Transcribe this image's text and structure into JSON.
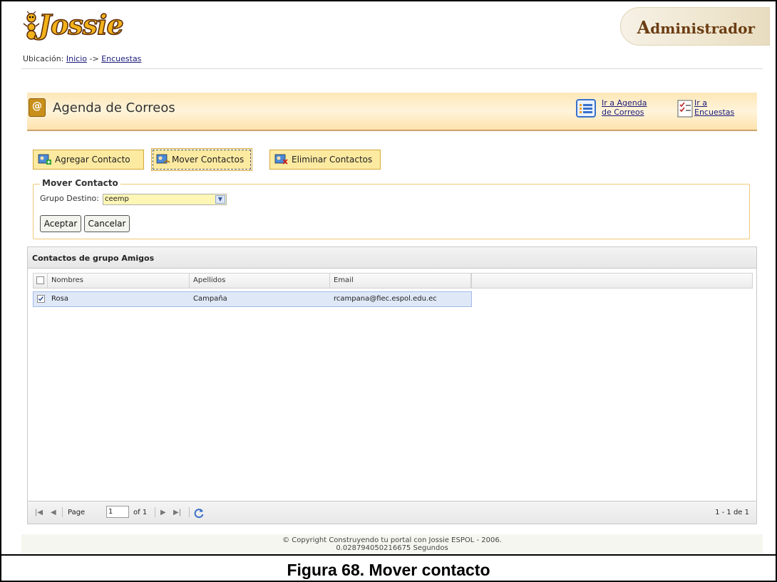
{
  "header": {
    "logo_text": "Jossie",
    "badge": "Administrador"
  },
  "breadcrumb": {
    "prefix": "Ubicación:",
    "home": "Inicio",
    "separator": "->",
    "current": "Encuestas"
  },
  "agenda": {
    "title": "Agenda de Correos",
    "link_agenda_1": "Ir a Agenda",
    "link_agenda_2": "de Correos",
    "link_encuestas_1": "Ir a",
    "link_encuestas_2": "Encuestas"
  },
  "actions": {
    "add": "Agregar Contacto",
    "move": "Mover Contactos",
    "delete": "Eliminar Contactos"
  },
  "move_form": {
    "legend": "Mover Contacto",
    "label": "Grupo Destino:",
    "selected": "ceemp",
    "ok": "Aceptar",
    "cancel": "Cancelar"
  },
  "grid": {
    "title": "Contactos de grupo Amigos",
    "columns": [
      "Nombres",
      "Apellidos",
      "Email"
    ],
    "rows": [
      {
        "nombres": "Rosa",
        "apellidos": "Campaña",
        "email": "rcampana@fiec.espol.edu.ec",
        "checked": true
      }
    ],
    "pager": {
      "page_label": "Page",
      "page_value": "1",
      "of_label": "of 1",
      "summary": "1 - 1 de 1"
    }
  },
  "footer": {
    "line1": "© Copyright Construyendo tu portal con Jossie ESPOL - 2006.",
    "line2": "0.028794050216675 Segundos"
  },
  "caption": "Figura 68. Mover contacto"
}
